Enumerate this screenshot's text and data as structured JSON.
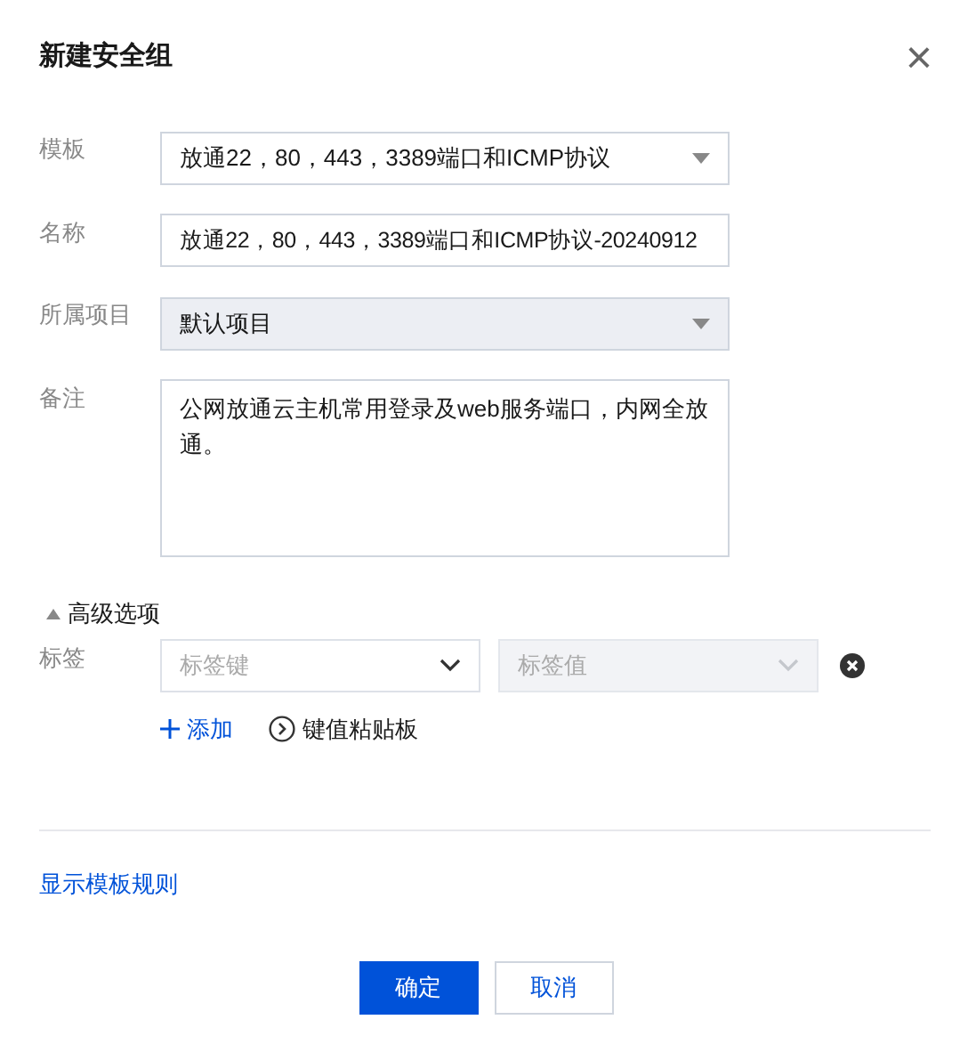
{
  "dialog": {
    "title": "新建安全组",
    "close": "×"
  },
  "fields": [
    {
      "kind": "select",
      "label": "模板",
      "value": "放通22，80，443，3389端口和ICMP协议",
      "disabled": false
    },
    {
      "kind": "input",
      "label": "名称",
      "value": "放通22，80，443，3389端口和ICMP协议-20240912"
    },
    {
      "kind": "select",
      "label": "所属项目",
      "value": "默认项目",
      "disabled": true
    },
    {
      "kind": "textarea",
      "label": "备注",
      "value": "公网放通云主机常用登录及web服务端口，内网全放通。"
    }
  ],
  "advanced": {
    "label": "高级选项",
    "expanded": true,
    "tags": {
      "label": "标签",
      "key": {
        "placeholder": "标签键",
        "disabled": false
      },
      "value": {
        "placeholder": "标签值",
        "disabled": true
      },
      "add": "添加",
      "paste": "键值粘贴板"
    }
  },
  "rules_link": "显示模板规则",
  "buttons": [
    {
      "label": "确定",
      "primary": true
    },
    {
      "label": "取消",
      "primary": false
    }
  ]
}
